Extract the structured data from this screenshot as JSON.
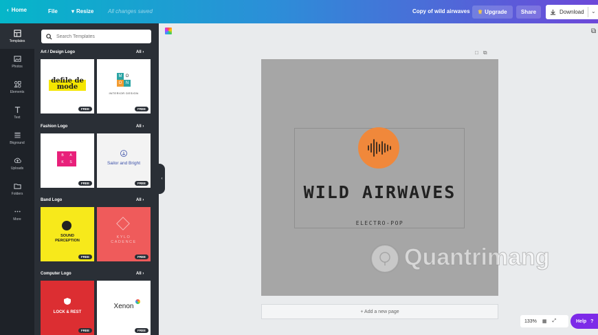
{
  "topbar": {
    "home_label": "Home",
    "file_label": "File",
    "resize_label": "Resize",
    "saved_status": "All changes saved",
    "doc_title": "Copy of wild airwaves",
    "upgrade_label": "Upgrade",
    "share_label": "Share",
    "download_label": "Download"
  },
  "rail": {
    "items": [
      {
        "label": "Templates",
        "icon": "templates-icon"
      },
      {
        "label": "Photos",
        "icon": "photos-icon"
      },
      {
        "label": "Elements",
        "icon": "elements-icon"
      },
      {
        "label": "Text",
        "icon": "text-icon"
      },
      {
        "label": "Bkground",
        "icon": "background-icon"
      },
      {
        "label": "Uploads",
        "icon": "uploads-icon"
      },
      {
        "label": "Folders",
        "icon": "folders-icon"
      },
      {
        "label": "More",
        "icon": "more-icon"
      }
    ]
  },
  "panel": {
    "search_placeholder": "Search Templates",
    "all_label": "All",
    "free_badge": "FREE",
    "sections": [
      {
        "title": "Art / Design Logo"
      },
      {
        "title": "Fashion Logo"
      },
      {
        "title": "Band Logo"
      },
      {
        "title": "Computer Logo"
      }
    ],
    "tiles": {
      "defile": "defile de mode",
      "monogram_letters": [
        "M",
        "O",
        "O",
        "N"
      ],
      "interior": "INTERIOR DESIGN",
      "baks_letters": [
        "B",
        "A",
        "K",
        "S"
      ],
      "sailor": "Sailor and Bright",
      "sound_line1": "SOUND",
      "sound_line2": "PERCEPTION",
      "kylo_line1": "KYLO",
      "kylo_line2": "CADENCE",
      "lock": "LOCK & REST",
      "xenon": "Xenon"
    }
  },
  "canvas": {
    "logo_title": "WILD AIRWAVES",
    "logo_subtitle": "ELECTRO-POP",
    "add_page_label": "+ Add a new page",
    "zoom_level": "133%"
  },
  "watermark": {
    "text": "Quantrimang"
  },
  "help": {
    "label": "Help",
    "symbol": "?"
  },
  "colors": {
    "accent_orange": "#f0883b",
    "help_purple": "#7d2ae8",
    "panel_dark": "#2a2f36"
  }
}
